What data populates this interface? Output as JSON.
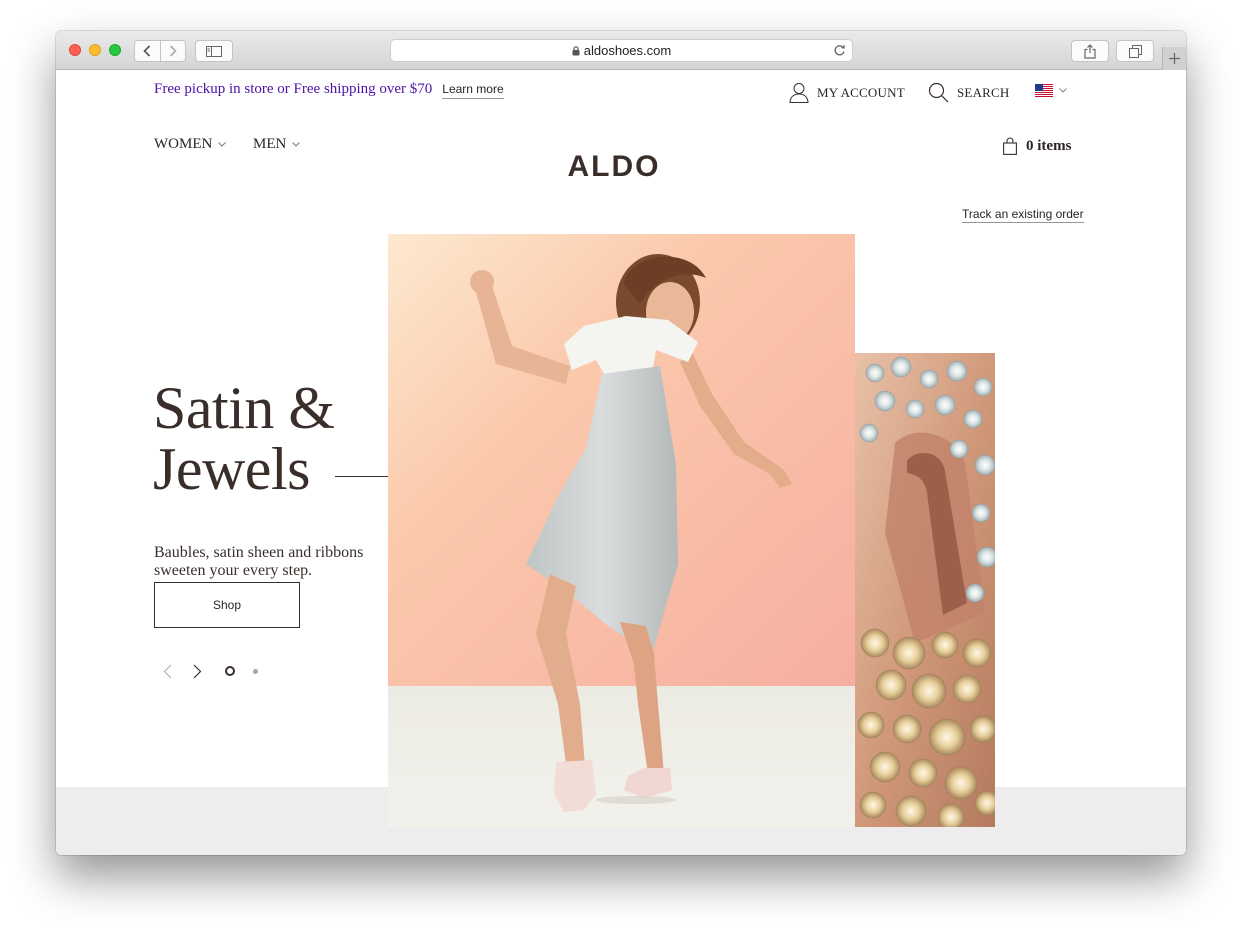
{
  "browser": {
    "url": "aldoshoes.com",
    "icons": [
      "back-icon",
      "forward-icon",
      "sidebar-icon",
      "lock-icon",
      "reload-icon",
      "share-icon",
      "tabs-icon",
      "new-tab-icon"
    ]
  },
  "promo": {
    "text": "Free pickup in store or Free shipping over $70",
    "link": "Learn more",
    "color": "#4b12a8"
  },
  "utility": {
    "account": "MY ACCOUNT",
    "search": "SEARCH",
    "country_flag": "us-flag-icon"
  },
  "nav": {
    "women": "WOMEN",
    "men": "MEN"
  },
  "logo": "ALDO",
  "cart": {
    "label": "0 items"
  },
  "track_order": "Track an existing order",
  "hero": {
    "title_line1": "Satin &",
    "title_line2": "Jewels",
    "subtitle": "Baubles, satin sheen and ribbons sweeten your every step.",
    "cta": "Shop",
    "slide_index": 1,
    "slide_count": 2
  },
  "colors": {
    "text": "#3a2e2b",
    "band": "#efeced",
    "photo_bg": "#f6b7a4"
  }
}
